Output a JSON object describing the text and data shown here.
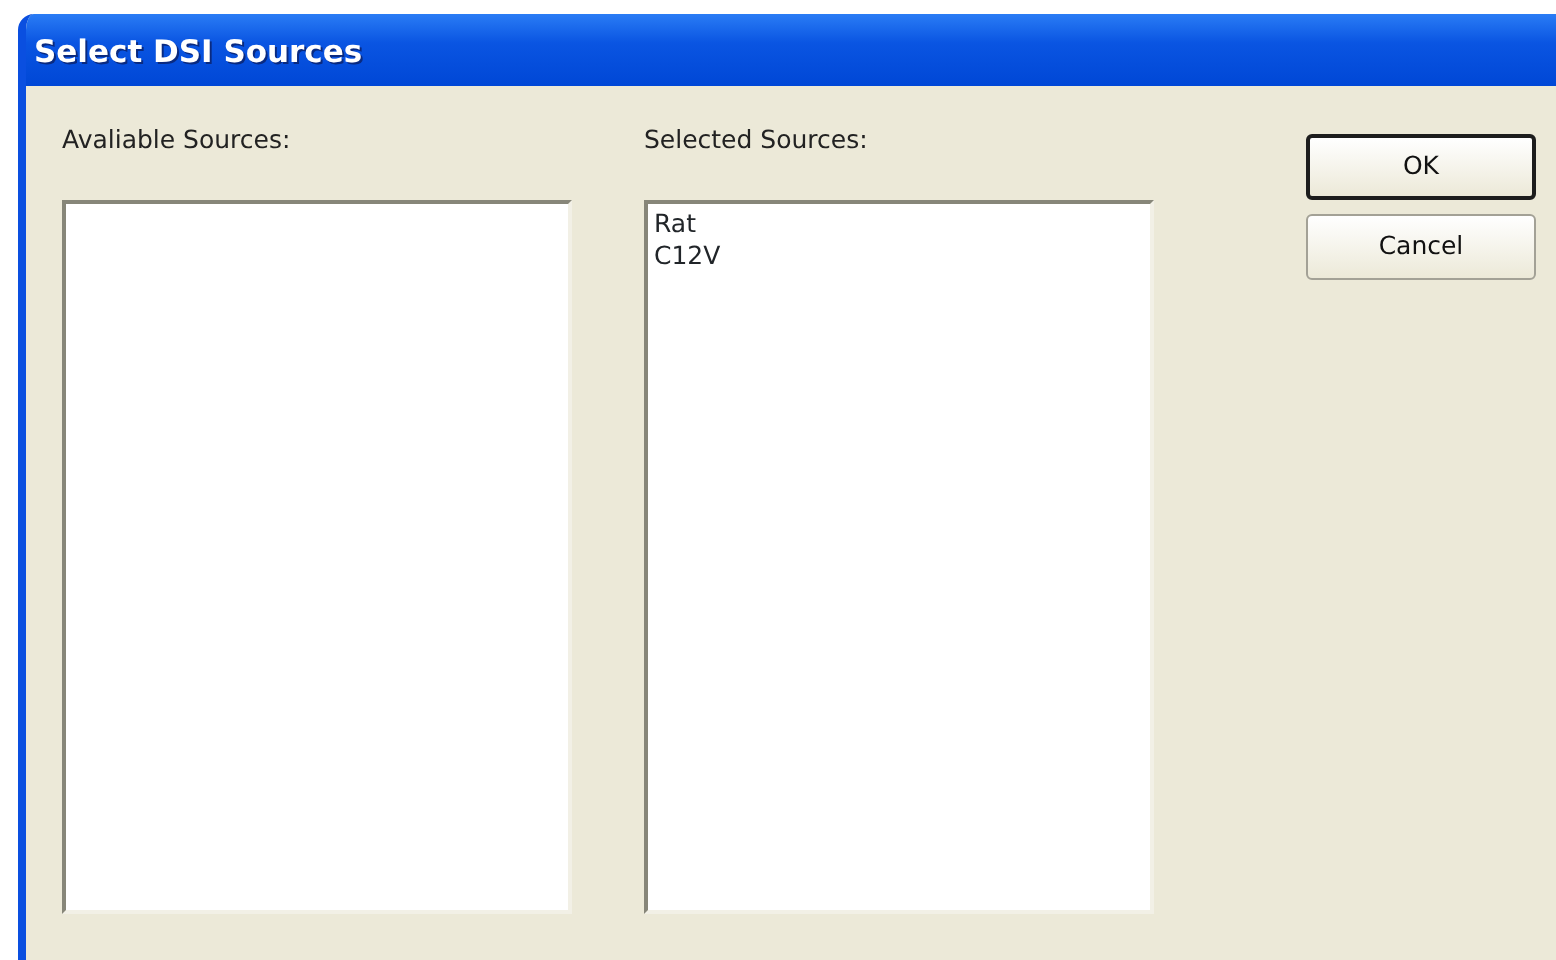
{
  "window": {
    "title": "Select DSI Sources"
  },
  "available": {
    "label": "Avaliable Sources:"
  },
  "selected": {
    "label": "Selected Sources:",
    "items": [
      "Rat",
      "C12V"
    ]
  },
  "buttons": [
    {
      "label": "OK",
      "default": true
    },
    {
      "label": "Cancel",
      "default": false
    }
  ]
}
